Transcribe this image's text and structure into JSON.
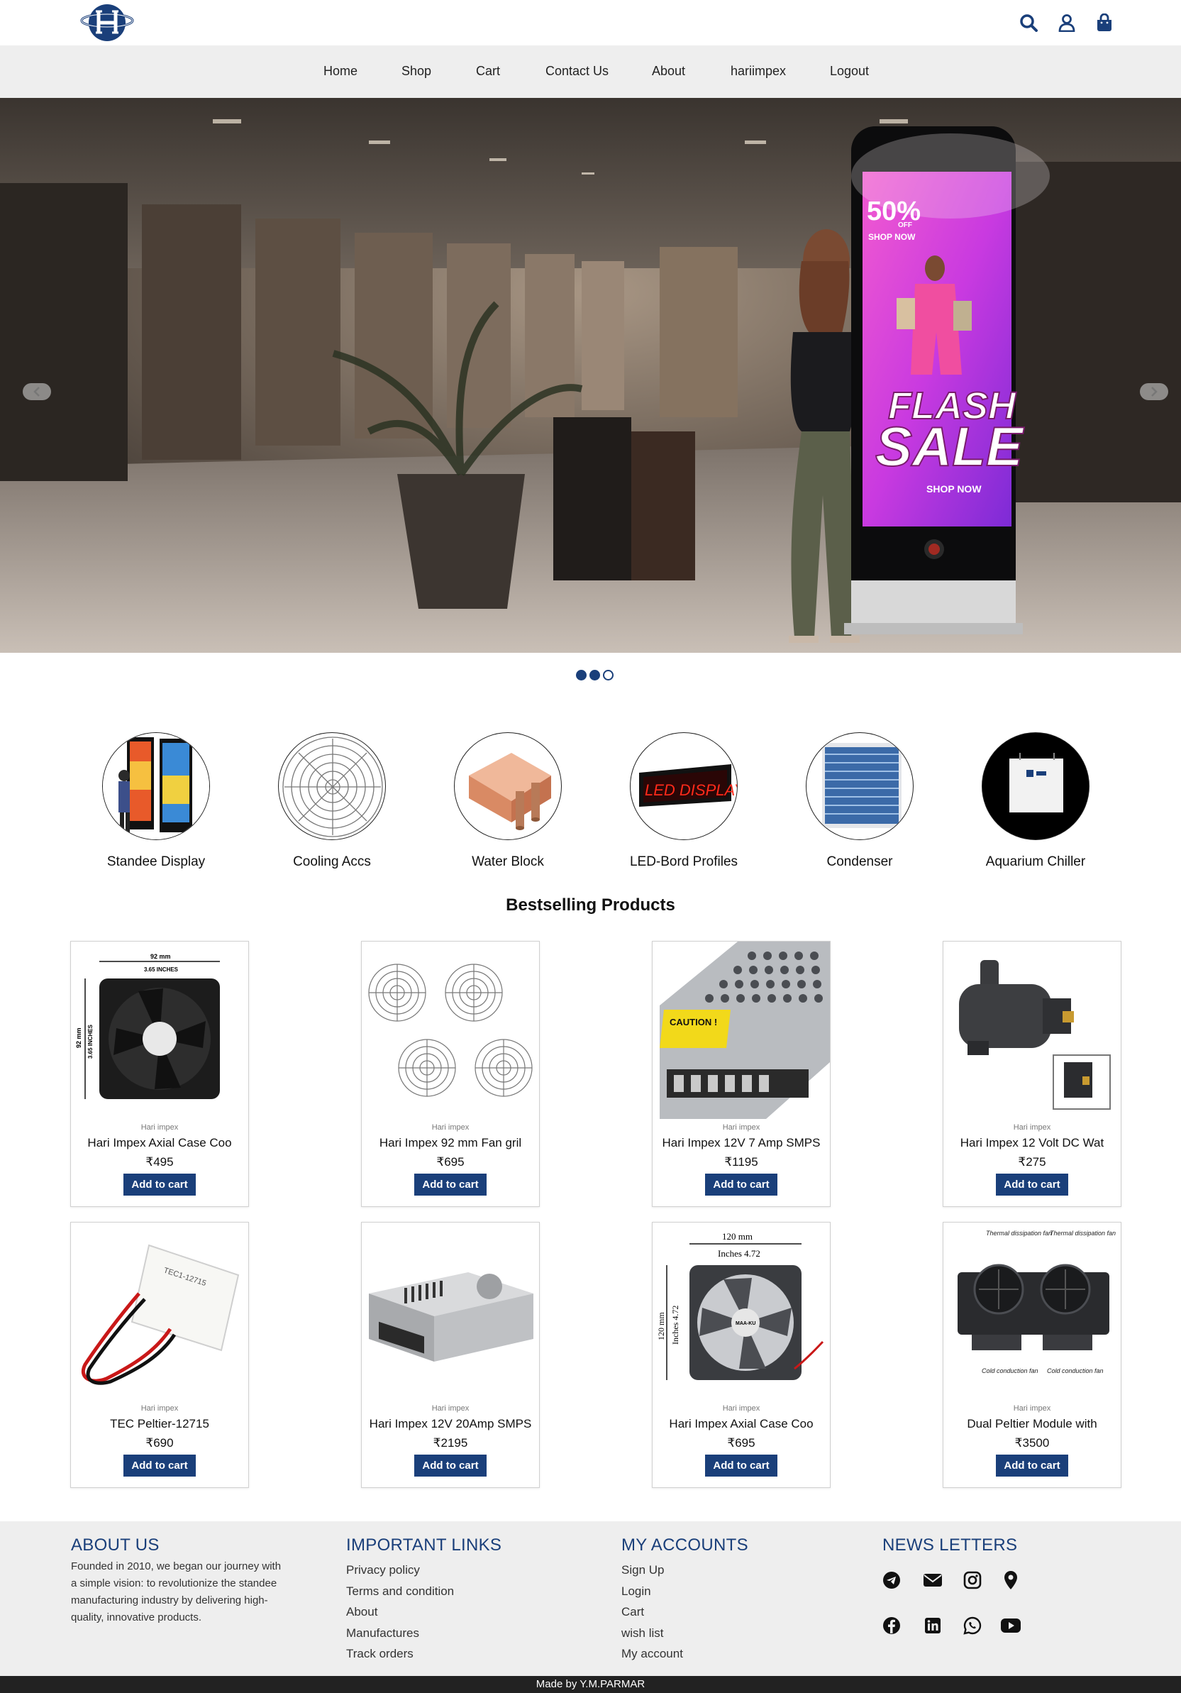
{
  "header": {
    "logo_alt": "Hari Impex logo",
    "icons": [
      "search-icon",
      "user-icon",
      "cart-bag-icon"
    ]
  },
  "nav": {
    "items": [
      {
        "label": "Home"
      },
      {
        "label": "Shop"
      },
      {
        "label": "Cart"
      },
      {
        "label": "Contact Us"
      },
      {
        "label": "About"
      },
      {
        "label": "hariimpex"
      },
      {
        "label": "Logout"
      }
    ]
  },
  "hero": {
    "screen_text": {
      "discount": "50%",
      "discount_off": "OFF",
      "shop_now_top": "SHOP NOW",
      "flash": "FLASH",
      "sale": "SALE",
      "shop_now": "SHOP NOW"
    },
    "slides_total": 3,
    "active_slide": 2
  },
  "categories": [
    {
      "label": "Standee Display"
    },
    {
      "label": "Cooling Accs"
    },
    {
      "label": "Water Block"
    },
    {
      "label": "LED-Bord Profiles"
    },
    {
      "label": "Condenser"
    },
    {
      "label": "Aquarium Chiller"
    }
  ],
  "category_art_text": {
    "led": "LED DISPLAY"
  },
  "bestselling": {
    "title": "Bestselling Products",
    "add_label": "Add to cart",
    "products": [
      {
        "brand": "Hari impex",
        "name": "Hari Impex Axial Case Coo",
        "price": "₹495"
      },
      {
        "brand": "Hari impex",
        "name": "Hari Impex 92 mm Fan gril",
        "price": "₹695"
      },
      {
        "brand": "Hari impex",
        "name": "Hari Impex 12V 7 Amp SMPS",
        "price": "₹1195"
      },
      {
        "brand": "Hari impex",
        "name": "Hari Impex 12 Volt DC Wat",
        "price": "₹275"
      },
      {
        "brand": "Hari impex",
        "name": "TEC Peltier-12715",
        "price": "₹690"
      },
      {
        "brand": "Hari impex",
        "name": "Hari Impex 12V 20Amp SMPS",
        "price": "₹2195"
      },
      {
        "brand": "Hari impex",
        "name": "Hari Impex Axial Case Coo",
        "price": "₹695"
      },
      {
        "brand": "Hari impex",
        "name": "Dual Peltier Module with",
        "price": "₹3500"
      }
    ]
  },
  "product_art_text": {
    "fan92_w": "92 mm",
    "fan92_w2": "3.65 INCHES",
    "fan92_h": "92 mm",
    "fan92_h2": "3.65 INCHES",
    "caution": "CAUTION !",
    "tec": "TEC1-12715",
    "fan120_w": "120 mm",
    "fan120_w2": "Inches 4.72",
    "fan120_h": "120 mm",
    "fan120_h2": "Inches 4.72",
    "fan120_brand": "MAA-KU",
    "peltier_t1": "Thermal dissipation fan",
    "peltier_t2": "Thermal dissipation fan",
    "peltier_b1": "Cold conduction fan",
    "peltier_b2": "Cold conduction fan"
  },
  "footer": {
    "about": {
      "title": "ABOUT US",
      "text": "Founded in 2010, we began our journey with a simple vision: to revolutionize the standee manufacturing industry by delivering high-quality, innovative products."
    },
    "important_links": {
      "title": "IMPORTANT LINKS",
      "items": [
        "Privacy policy",
        "Terms and condition",
        "About",
        "Manufactures",
        "Track orders"
      ]
    },
    "my_accounts": {
      "title": "MY ACCOUNTS",
      "items": [
        "Sign Up",
        "Login",
        "Cart",
        "wish list",
        "My account"
      ]
    },
    "newsletters": {
      "title": "NEWS LETTERS",
      "icons": [
        "telegram-icon",
        "email-icon",
        "instagram-icon",
        "location-icon",
        "facebook-icon",
        "linkedin-icon",
        "whatsapp-icon",
        "youtube-icon"
      ]
    },
    "credit": "Made by Y.M.PARMAR"
  },
  "colors": {
    "brand": "#1a3f7a",
    "nav_bg": "#eeeeee",
    "footer_bg": "#eeeeee",
    "bottom_bar": "#222222"
  }
}
